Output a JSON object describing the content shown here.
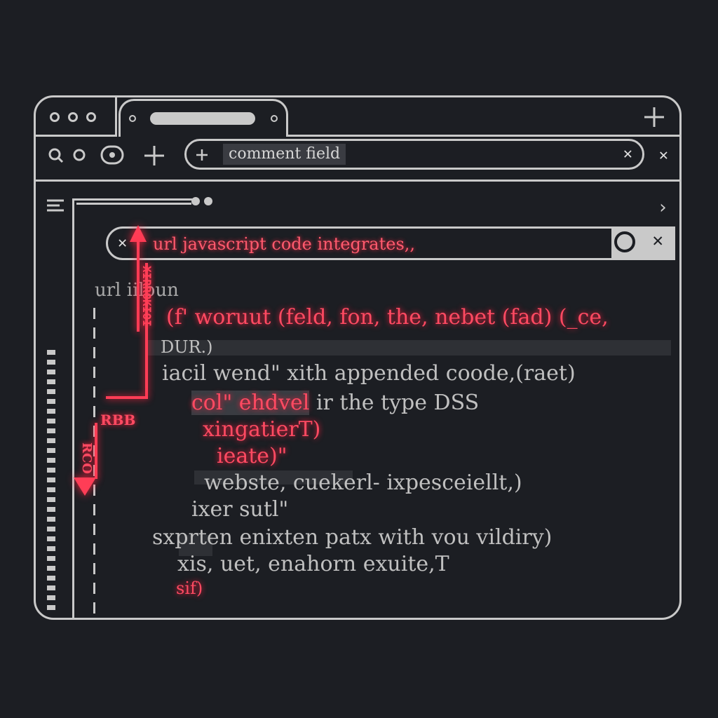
{
  "browser": {
    "tab": {
      "label": ""
    },
    "address_bar": {
      "value": "comment field"
    },
    "icons": [
      "window-dot-icon",
      "plus-icon",
      "close-icon",
      "search-icon",
      "menu-icon",
      "chevron-right-icon"
    ]
  },
  "search": {
    "value": "url javascript code integrates,,"
  },
  "annotation": {
    "vertical_text": "XIRROKIOI",
    "label": "RBB",
    "label2": "RCO"
  },
  "code_lines": [
    {
      "text": "url iiloun"
    },
    {
      "text": "(f' woruut (feld, fon, the, nebet (fad) (_ce,"
    },
    {
      "text": "DUR.)"
    },
    {
      "text": "iacil wend\" xith appended coode,(raet)"
    },
    {
      "text": "col\" ehdvel",
      "rest": " ir the type DSS"
    },
    {
      "text": "xingatierT)"
    },
    {
      "text": "ieate)\""
    },
    {
      "text": "webste, cuekerl- ixpesceiellt,)"
    },
    {
      "text": "ixer sutl\""
    },
    {
      "text": "sxprten enixten patx with vou vildiry)"
    },
    {
      "text": "xis, uet, enahorn exuite,T"
    },
    {
      "text": "sif)"
    }
  ],
  "colors": {
    "background": "#1c1e23",
    "outline": "#c9c9c9",
    "accent_red": "#ff4a62"
  }
}
